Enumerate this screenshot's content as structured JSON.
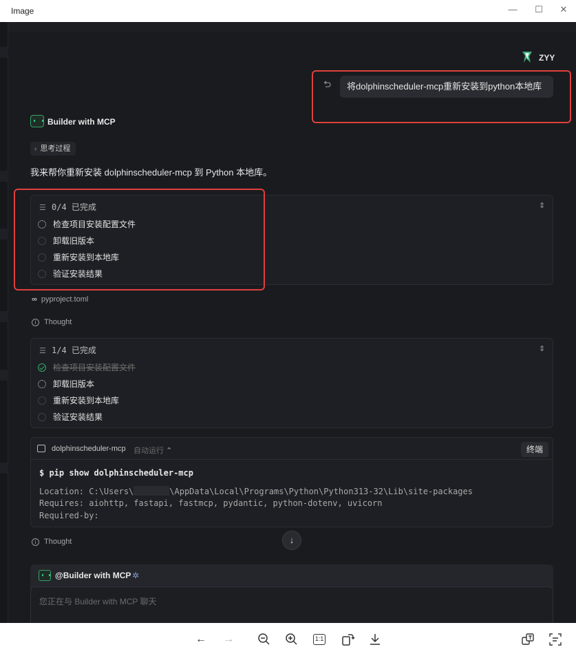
{
  "window": {
    "title": "Image",
    "controls": [
      "—",
      "☐",
      "✕"
    ]
  },
  "user": {
    "name": "ZYY",
    "message": "将dolphinscheduler-mcp重新安装到python本地库"
  },
  "assistant": {
    "name": "Builder with MCP",
    "think_label": "思考过程",
    "intro": "我来帮你重新安装 dolphinscheduler-mcp 到 Python 本地库。"
  },
  "tasks_1": {
    "status": "0/4 已完成",
    "items": [
      "检查项目安装配置文件",
      "卸载旧版本",
      "重新安装到本地库",
      "验证安装结果"
    ]
  },
  "file_ref": "pyproject.toml",
  "thought_label": "Thought",
  "tasks_2": {
    "status": "1/4 已完成",
    "items": [
      "检查项目安装配置文件",
      "卸载旧版本",
      "重新安装到本地库",
      "验证安装结果"
    ]
  },
  "terminal": {
    "name": "dolphinscheduler-mcp",
    "mode": "自动运行",
    "stop_label": "终端",
    "command": "$ pip show dolphinscheduler-mcp",
    "location_prefix": "Location: C:\\Users\\",
    "location_suffix": "\\AppData\\Local\\Programs\\Python\\Python313-32\\Lib\\site-packages",
    "requires": "Requires: aiohttp, fastapi, fastmcp, pydantic, python-dotenv, uvicorn",
    "required_by": "Required-by:"
  },
  "thought_label_2": "Thought",
  "composer": {
    "mention": "@Builder with MCP",
    "placeholder": "您正在与 Builder with MCP 聊天"
  },
  "toolbar": {
    "icons": [
      "arrow-left-icon",
      "arrow-right-icon",
      "zoom-out-icon",
      "zoom-in-icon",
      "actual-size-icon",
      "rotate-icon",
      "download-icon",
      "translate-icon",
      "text-recognition-icon"
    ],
    "actual_size_label": "1:1"
  },
  "colors": {
    "background": "#1a1b1f",
    "accent_green": "#2fae6b",
    "highlight_red": "#e0403c"
  }
}
